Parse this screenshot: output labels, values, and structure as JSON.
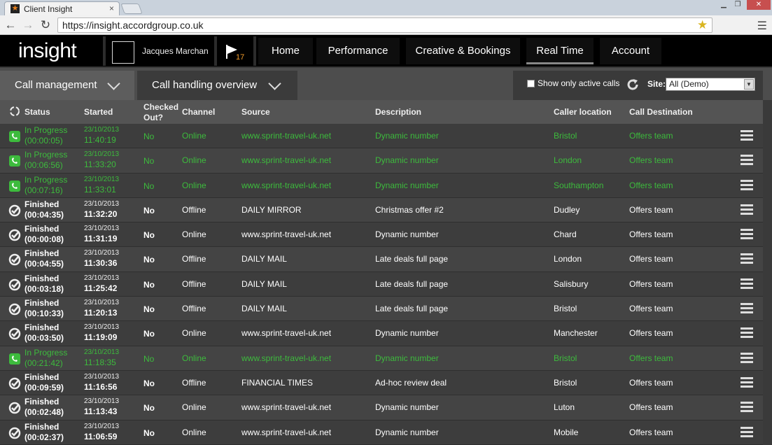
{
  "browser": {
    "tab_title": "Client Insight",
    "tab_close": "×",
    "url": "https://insight.accordgroup.co.uk",
    "window_min": "▁",
    "window_max": "❐",
    "window_close": "✕"
  },
  "app": {
    "logo": "insight",
    "user_name": "Jacques Marchan",
    "flag_count": "17",
    "nav": [
      {
        "label": "Home"
      },
      {
        "label": "Performance"
      },
      {
        "label": "Creative & Bookings"
      },
      {
        "label": "Real Time"
      },
      {
        "label": "Account"
      }
    ]
  },
  "subbar": {
    "tab1": "Call management",
    "tab2": "Call handling overview",
    "show_active_label": "Show only active calls",
    "site_label": "Site:",
    "site_value": "All (Demo)"
  },
  "table": {
    "headers": {
      "status": "Status",
      "started": "Started",
      "checked_out": "Checked Out?",
      "channel": "Channel",
      "source": "Source",
      "description": "Description",
      "caller_location": "Caller location",
      "call_destination": "Call Destination"
    },
    "rows": [
      {
        "status": "In Progress",
        "duration": "(00:00:05)",
        "date": "23/10/2013",
        "time": "11:40:19",
        "checked_out": "No",
        "channel": "Online",
        "source": "www.sprint-travel-uk.net",
        "description": "Dynamic number",
        "location": "Bristol",
        "destination": "Offers team"
      },
      {
        "status": "In Progress",
        "duration": "(00:06:56)",
        "date": "23/10/2013",
        "time": "11:33:20",
        "checked_out": "No",
        "channel": "Online",
        "source": "www.sprint-travel-uk.net",
        "description": "Dynamic number",
        "location": "London",
        "destination": "Offers team"
      },
      {
        "status": "In Progress",
        "duration": "(00:07:16)",
        "date": "23/10/2013",
        "time": "11:33:01",
        "checked_out": "No",
        "channel": "Online",
        "source": "www.sprint-travel-uk.net",
        "description": "Dynamic number",
        "location": "Southampton",
        "destination": "Offers team"
      },
      {
        "status": "Finished",
        "duration": "(00:04:35)",
        "date": "23/10/2013",
        "time": "11:32:20",
        "checked_out": "No",
        "channel": "Offline",
        "source": "DAILY MIRROR",
        "description": "Christmas offer #2",
        "location": "Dudley",
        "destination": "Offers team"
      },
      {
        "status": "Finished",
        "duration": "(00:00:08)",
        "date": "23/10/2013",
        "time": "11:31:19",
        "checked_out": "No",
        "channel": "Online",
        "source": "www.sprint-travel-uk.net",
        "description": "Dynamic number",
        "location": "Chard",
        "destination": "Offers team"
      },
      {
        "status": "Finished",
        "duration": "(00:04:55)",
        "date": "23/10/2013",
        "time": "11:30:36",
        "checked_out": "No",
        "channel": "Offline",
        "source": "DAILY MAIL",
        "description": "Late deals full page",
        "location": "London",
        "destination": "Offers team"
      },
      {
        "status": "Finished",
        "duration": "(00:03:18)",
        "date": "23/10/2013",
        "time": "11:25:42",
        "checked_out": "No",
        "channel": "Offline",
        "source": "DAILY MAIL",
        "description": "Late deals full page",
        "location": "Salisbury",
        "destination": "Offers team"
      },
      {
        "status": "Finished",
        "duration": "(00:10:33)",
        "date": "23/10/2013",
        "time": "11:20:13",
        "checked_out": "No",
        "channel": "Offline",
        "source": "DAILY MAIL",
        "description": "Late deals full page",
        "location": "Bristol",
        "destination": "Offers team"
      },
      {
        "status": "Finished",
        "duration": "(00:03:50)",
        "date": "23/10/2013",
        "time": "11:19:09",
        "checked_out": "No",
        "channel": "Online",
        "source": "www.sprint-travel-uk.net",
        "description": "Dynamic number",
        "location": "Manchester",
        "destination": "Offers team"
      },
      {
        "status": "In Progress",
        "duration": "(00:21:42)",
        "date": "23/10/2013",
        "time": "11:18:35",
        "checked_out": "No",
        "channel": "Online",
        "source": "www.sprint-travel-uk.net",
        "description": "Dynamic number",
        "location": "Bristol",
        "destination": "Offers team"
      },
      {
        "status": "Finished",
        "duration": "(00:09:59)",
        "date": "23/10/2013",
        "time": "11:16:56",
        "checked_out": "No",
        "channel": "Offline",
        "source": "FINANCIAL TIMES",
        "description": "Ad-hoc review deal",
        "location": "Bristol",
        "destination": "Offers team"
      },
      {
        "status": "Finished",
        "duration": "(00:02:48)",
        "date": "23/10/2013",
        "time": "11:13:43",
        "checked_out": "No",
        "channel": "Online",
        "source": "www.sprint-travel-uk.net",
        "description": "Dynamic number",
        "location": "Luton",
        "destination": "Offers team"
      },
      {
        "status": "Finished",
        "duration": "(00:02:37)",
        "date": "23/10/2013",
        "time": "11:06:59",
        "checked_out": "No",
        "channel": "Online",
        "source": "www.sprint-travel-uk.net",
        "description": "Dynamic number",
        "location": "Mobile",
        "destination": "Offers team"
      }
    ]
  },
  "colors": {
    "in_progress": "#3dbb3d",
    "finished": "#ffffff",
    "flag_badge": "#f09a2a"
  },
  "icons": {
    "in_progress": "phone-active-icon",
    "finished": "check-circle-icon",
    "row_menu": "hamburger-icon"
  }
}
